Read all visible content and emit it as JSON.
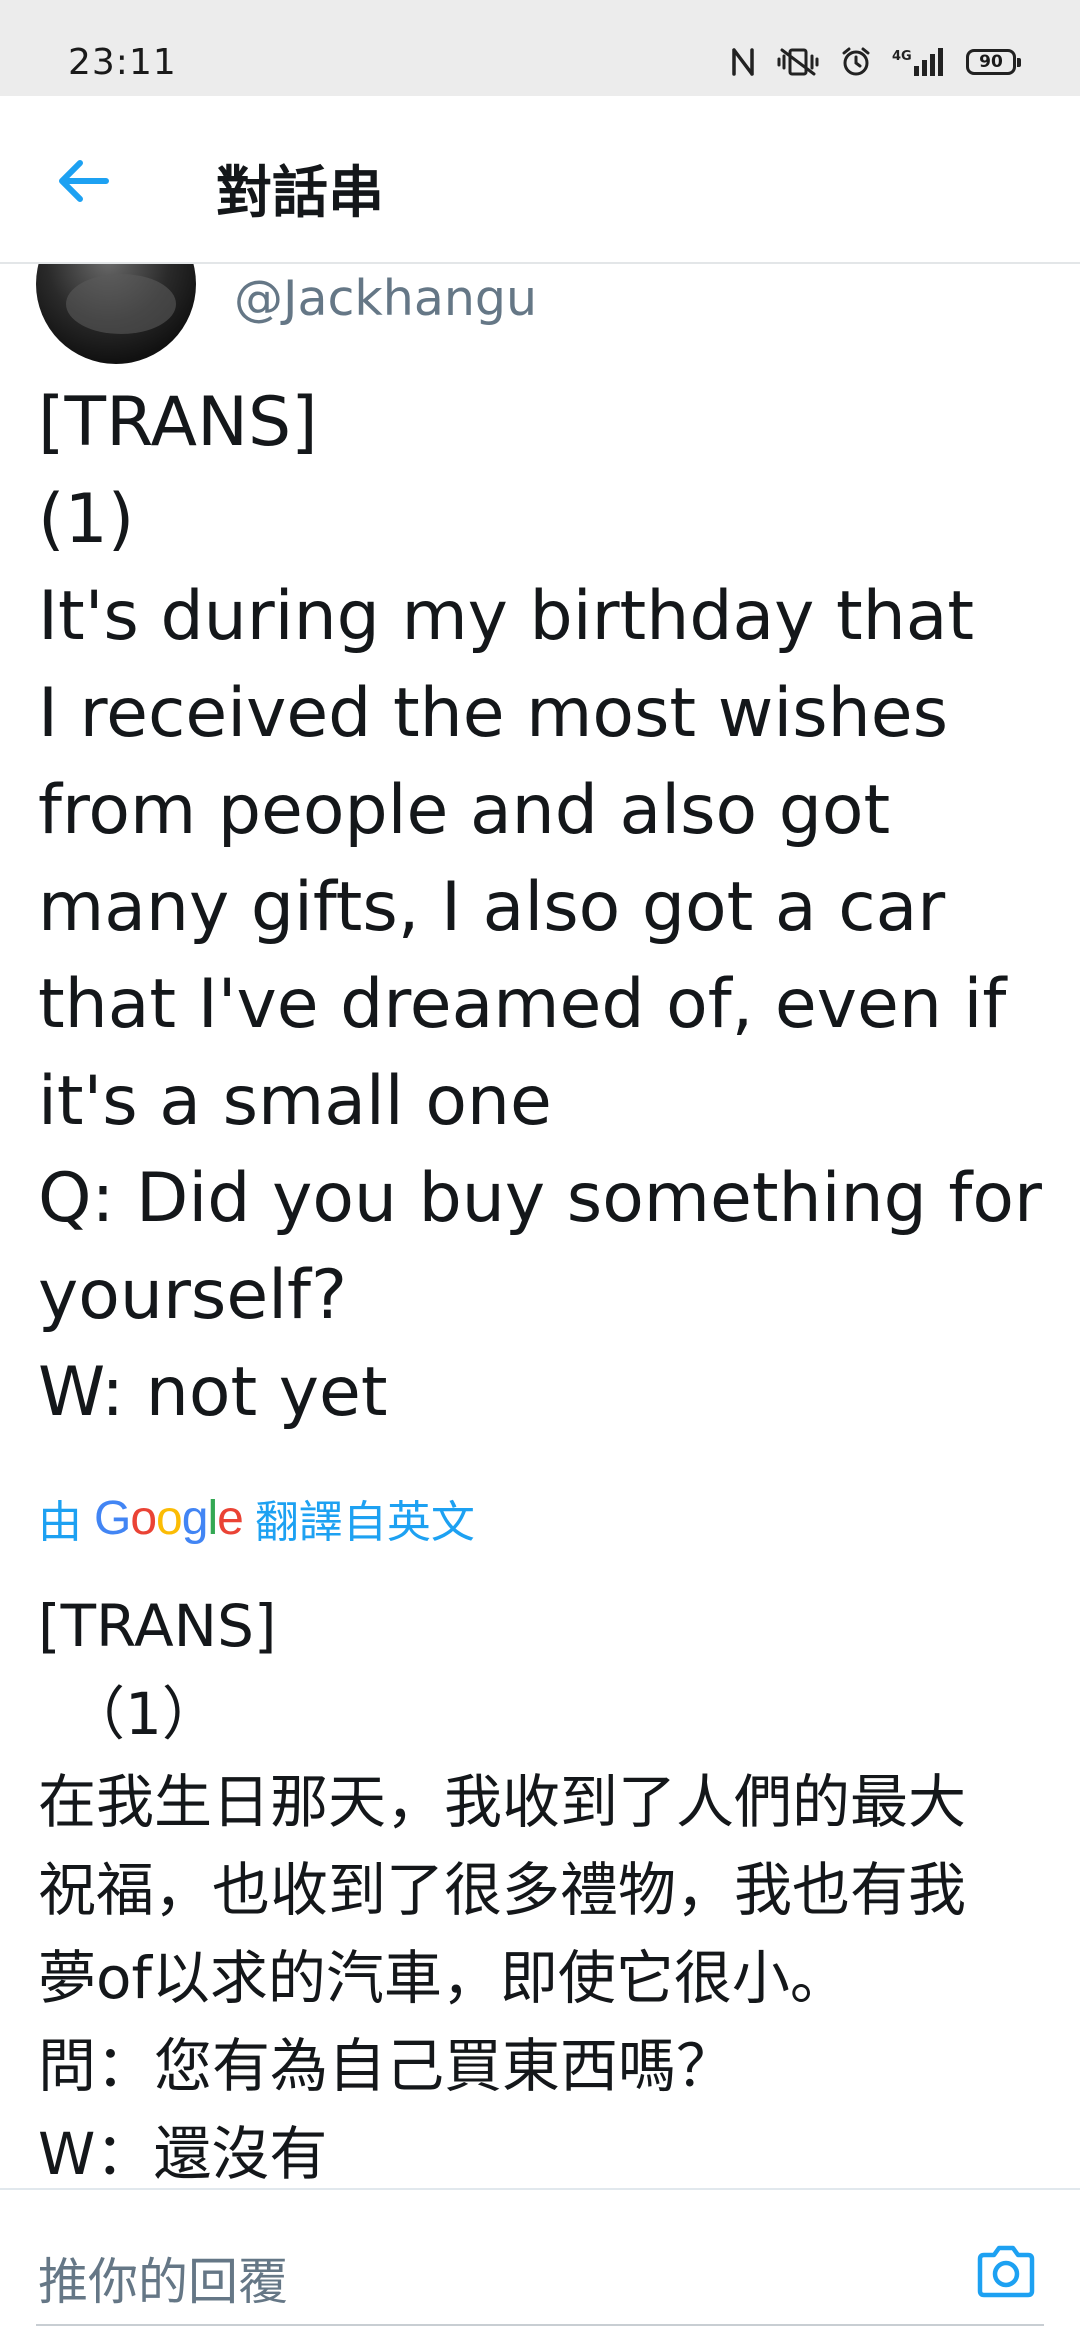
{
  "status_bar": {
    "time": "23:11",
    "battery": "90",
    "icons": [
      "nfc-icon",
      "vibrate-icon",
      "alarm-icon",
      "signal-4g-icon",
      "battery-icon"
    ]
  },
  "header": {
    "title": "對話串",
    "back_icon": "arrow-left-icon"
  },
  "tweet": {
    "handle": "@Jackhangu",
    "text": "[TRANS]\n(1)\nIt's during my birthday that\nI received the most wishes\nfrom people and also got\nmany gifts, I also got a car\nthat I've dreamed of, even if\nit's a small one\nQ: Did you buy something for\nyourself?\nW: not yet",
    "translate_prefix": "由",
    "translate_brand": "Google",
    "translate_suffix": "翻譯自英文",
    "translated_text": "[TRANS]\n　（1）\n在我生日那天，我收到了人們的最大\n祝福，也收到了很多禮物，我也有我\n夢of以求的汽車，即使它很小。\n問：您有為自己買東西嗎？\n W：還沒有"
  },
  "reply": {
    "placeholder": "推你的回覆",
    "camera_icon": "camera-icon"
  },
  "colors": {
    "accent": "#1da1f2",
    "secondary_text": "#657786",
    "primary_text": "#14171a"
  }
}
